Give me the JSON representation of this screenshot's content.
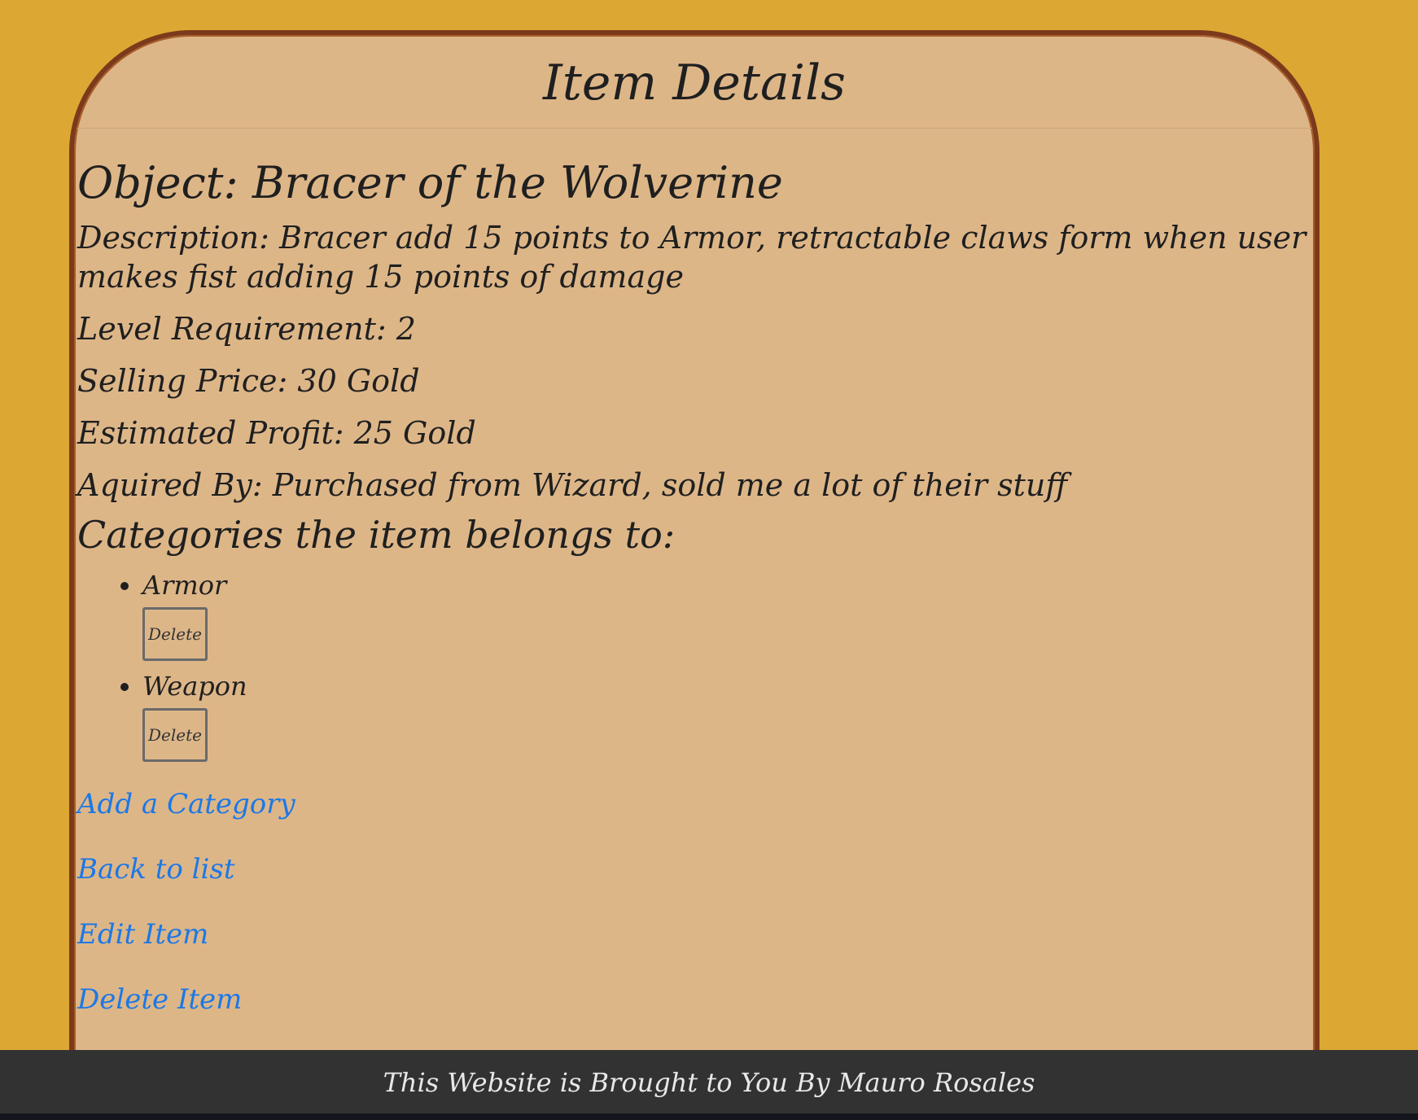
{
  "page": {
    "title": "Item Details"
  },
  "item": {
    "object": "Object: Bracer of the Wolverine",
    "description": "Description: Bracer add 15 points to Armor, retractable claws form when user makes fist adding 15 points of damage",
    "level": "Level Requirement: 2",
    "price": "Selling Price: 30 Gold",
    "profit": "Estimated Profit: 25 Gold",
    "acquired": "Aquired By: Purchased from Wizard, sold me a lot of their stuff"
  },
  "categories": {
    "heading": "Categories the item belongs to:",
    "items": [
      {
        "label": "Armor",
        "delete_label": "Delete"
      },
      {
        "label": "Weapon",
        "delete_label": "Delete"
      }
    ]
  },
  "links": {
    "add_category": "Add a Category",
    "back": "Back to list",
    "edit": "Edit Item",
    "delete": "Delete Item"
  },
  "footer": {
    "text": "This Website is Brought to You By Mauro Rosales"
  },
  "colors": {
    "background": "#dda733",
    "card": "#ddb688",
    "border": "#7b3a1b",
    "link": "#1c78e6",
    "footer": "#323232"
  }
}
